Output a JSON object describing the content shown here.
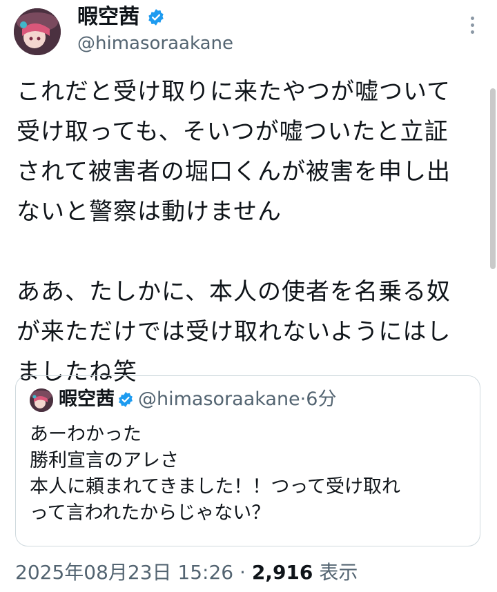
{
  "author": {
    "display_name": "暇空茜",
    "handle": "@himasoraakane"
  },
  "tweet": {
    "text": "これだと受け取りに来たやつが嘘ついて\n受け取っても、そいつが嘘ついたと立証\nされて被害者の堀口くんが被害を申し出\nないと警察は動けません\n\nああ、たしかに、本人の使者を名乗る奴\nが来ただけでは受け取れないようにはし\nましたね笑"
  },
  "quoted_tweet": {
    "display_name": "暇空茜",
    "handle": "@himasoraakane",
    "separator": "·",
    "time": "6分",
    "text": "あーわかった\n勝利宣言のアレさ\n本人に頼まれてきました！！つって受け取れ\nって言われたからじゃない？"
  },
  "meta": {
    "timestamp": "2025年08月23日 15:26",
    "separator": "·",
    "views_count": "2,916",
    "views_label": "表示"
  },
  "colors": {
    "verified": "#1d9bf0",
    "secondary_text": "#536471",
    "border": "#cfd9de"
  }
}
